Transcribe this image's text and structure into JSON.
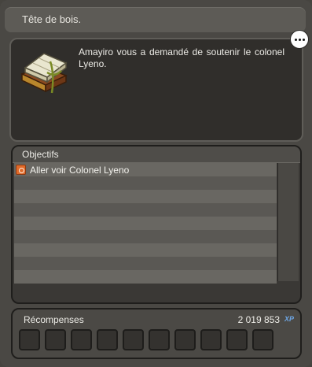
{
  "window": {
    "title": "Tête de bois."
  },
  "quest": {
    "description": "Amayiro vous a demandé de soutenir le colonel Lyeno.",
    "icon": "quest-book-icon"
  },
  "menu_button": {
    "icon": "ellipsis-icon"
  },
  "objectives": {
    "title": "Objectifs",
    "items": [
      {
        "label": "Aller voir Colonel Lyeno",
        "icon": "objective-target-icon"
      }
    ]
  },
  "rewards": {
    "title": "Récompenses",
    "xp_value": "2 019 853",
    "xp_unit": "XP"
  },
  "colors": {
    "accent": "#e06a2a",
    "xp": "#6ea7e6"
  }
}
